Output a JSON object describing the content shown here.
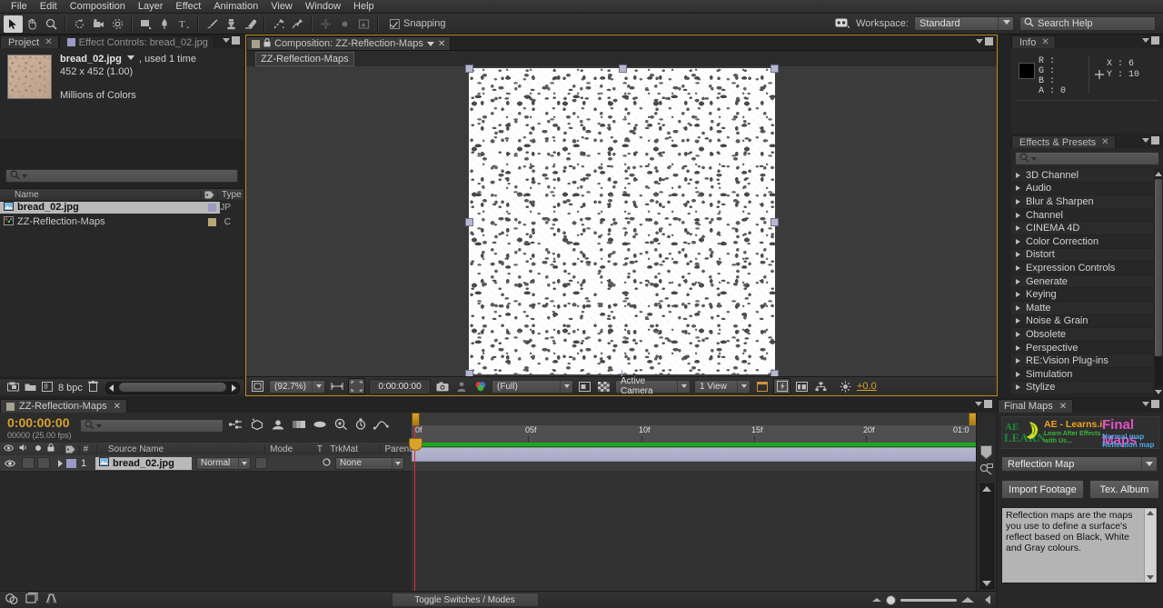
{
  "menu": {
    "items": [
      "File",
      "Edit",
      "Composition",
      "Layer",
      "Effect",
      "Animation",
      "View",
      "Window",
      "Help"
    ]
  },
  "toolbar": {
    "snapping_label": "Snapping",
    "snapping_checked": true,
    "workspace_label": "Workspace:",
    "workspace_value": "Standard",
    "search_help_placeholder": "Search Help",
    "tools": [
      "selection-tool",
      "hand-tool",
      "zoom-tool",
      "rotation-tool",
      "camera-tool",
      "pan-behind-tool",
      "shape-tool",
      "pen-tool",
      "type-tool",
      "brush-tool",
      "clone-stamp-tool",
      "eraser-tool",
      "roto-brush-tool",
      "puppet-pin-tool"
    ]
  },
  "project": {
    "tabs": [
      {
        "label": "Project",
        "active": true,
        "closable": true
      },
      {
        "label": "Effect Controls: bread_02.jpg",
        "active": false,
        "closable": false
      }
    ],
    "selected_item": {
      "name": "bread_02.jpg",
      "used": ", used 1 time",
      "dimensions": "452 x 452 (1.00)",
      "color_depth": "Millions of Colors"
    },
    "search_placeholder": "",
    "columns": {
      "name": "Name",
      "type": "Type"
    },
    "items": [
      {
        "name": "bread_02.jpg",
        "type": "JPEG",
        "type_short": "JP",
        "icon": "footage-icon",
        "swatch": "#9a9ac4",
        "selected": true
      },
      {
        "name": "ZZ-Reflection-Maps",
        "type": "Composition",
        "type_short": "C",
        "icon": "composition-icon",
        "swatch": "#b8a878",
        "selected": false
      }
    ],
    "footer": {
      "bit_depth": "8 bpc"
    }
  },
  "composition": {
    "tab_label": "Composition: ZZ-Reflection-Maps",
    "breadcrumb": "ZZ-Reflection-Maps",
    "footer": {
      "zoom": "(92.7%)",
      "timecode": "0:00:00:00",
      "resolution": "(Full)",
      "camera": "Active Camera",
      "views": "1 View",
      "exposure": "+0.0"
    }
  },
  "info": {
    "tab_label": "Info",
    "r_label": "R :",
    "g_label": "G :",
    "b_label": "B :",
    "a_label": "A : 0",
    "x_label": "X : 6",
    "y_label": "Y : 10",
    "swatch_color": "#000000"
  },
  "effects": {
    "tab_label": "Effects & Presets",
    "search_placeholder": "",
    "categories": [
      "3D Channel",
      "Audio",
      "Blur & Sharpen",
      "Channel",
      "CINEMA 4D",
      "Color Correction",
      "Distort",
      "Expression Controls",
      "Generate",
      "Keying",
      "Matte",
      "Noise & Grain",
      "Obsolete",
      "Perspective",
      "RE:Vision Plug-ins",
      "Simulation",
      "Stylize"
    ]
  },
  "timeline": {
    "tab_label": "ZZ-Reflection-Maps",
    "current_time": "0:00:00:00",
    "frame_info": "00000 (25.00 fps)",
    "search_placeholder": "",
    "columns": [
      "#",
      "Source Name",
      "Mode",
      "T",
      "TrkMat",
      "Parent"
    ],
    "layers": [
      {
        "index": "1",
        "source_name": "bread_02.jpg",
        "mode": "Normal",
        "trkmat": "",
        "parent": "None"
      }
    ],
    "ruler_ticks": [
      {
        "label": "0f",
        "pos": 0
      },
      {
        "label": "05f",
        "pos": 20
      },
      {
        "label": "10f",
        "pos": 40
      },
      {
        "label": "15f",
        "pos": 60
      },
      {
        "label": "20f",
        "pos": 80
      },
      {
        "label": "01:0",
        "pos": 99.2
      }
    ],
    "footer": {
      "toggle_label": "Toggle Switches / Modes"
    }
  },
  "final_maps": {
    "tab_label": "Final Maps",
    "brand": {
      "site": "AE - Learns.ir",
      "tagline1": "Learn After Effects",
      "tagline2": "with Us...",
      "title": "Final Maps",
      "sub1": "Normal map",
      "sub2": "Reflection map",
      "logo_text_1": "AE",
      "logo_text_2": "LEARN"
    },
    "map_select": "Reflection Map",
    "import_button": "Import Footage",
    "album_button": "Tex. Album",
    "description": "Reflection maps are the maps you use to define a surface's reflect based on Black, White and Gray colours."
  },
  "colors": {
    "accent_orange": "#d8a22b",
    "panel_bg": "#282828",
    "chrome_bg": "#232323",
    "selection": "#b9b9b9",
    "render_green": "#1ea81e",
    "cti_red": "#e02b2b",
    "layer_bar": "#b6b6cf"
  }
}
